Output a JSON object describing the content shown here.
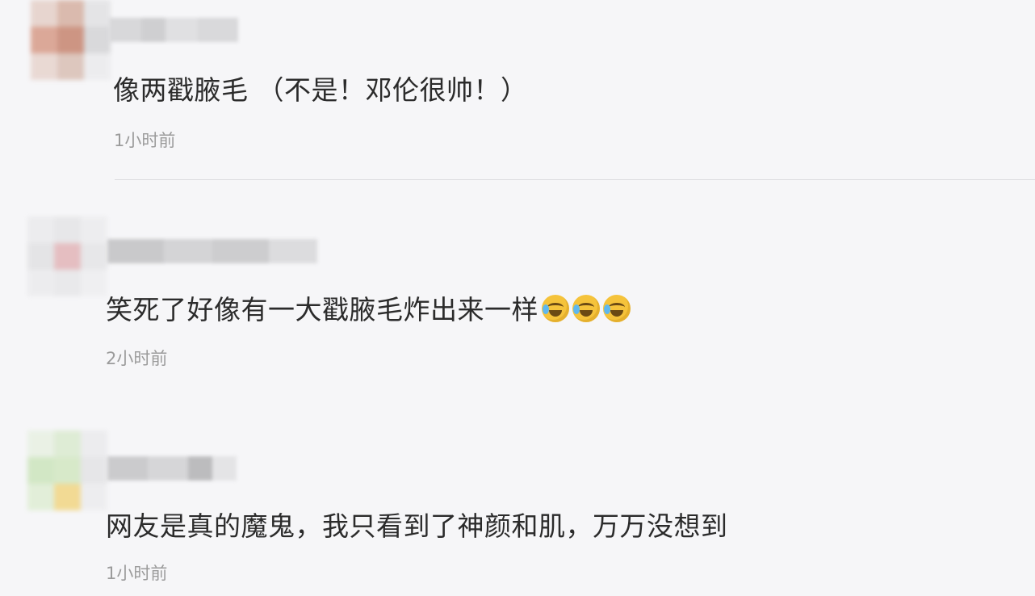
{
  "comments": [
    {
      "text": "像两戳腋毛 （不是！邓伦很帅！）",
      "time": "1小时前"
    },
    {
      "text": "笑死了好像有一大戳腋毛炸出来一样",
      "time": "2小时前",
      "emojis": [
        "laugh-cry-emoji",
        "laugh-cry-emoji",
        "laugh-cry-emoji"
      ]
    },
    {
      "text": "网友是真的魔鬼，我只看到了神颜和肌，万万没想到",
      "time": "1小时前"
    }
  ],
  "colors": {
    "background": "#f6f6f8",
    "text": "#2b2b2b",
    "timestamp": "#9b9b9b",
    "divider": "#dcdcdf",
    "emoji": "#f5c33b"
  }
}
